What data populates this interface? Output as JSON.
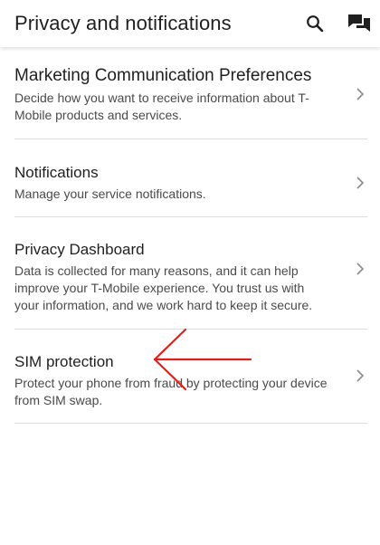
{
  "header": {
    "title": "Privacy and notifications",
    "search_icon": "search-icon",
    "chat_icon": "chat-icon"
  },
  "items": [
    {
      "title": "Marketing Communication Preferences",
      "description": "Decide how you want to receive information about T-Mobile products and services."
    },
    {
      "title": "Notifications",
      "description": "Manage your service notifications."
    },
    {
      "title": "Privacy Dashboard",
      "description": "Data is collected for many reasons, and it can help improve your T-Mobile experience.  You trust us with your information, and we work hard to keep it secure."
    },
    {
      "title": "SIM protection",
      "description": "Protect your phone from fraud by protecting your device from SIM swap."
    }
  ],
  "colors": {
    "annotation_arrow": "#e0201b",
    "divider": "#dcdcdc",
    "chevron": "#8a8a8a"
  }
}
